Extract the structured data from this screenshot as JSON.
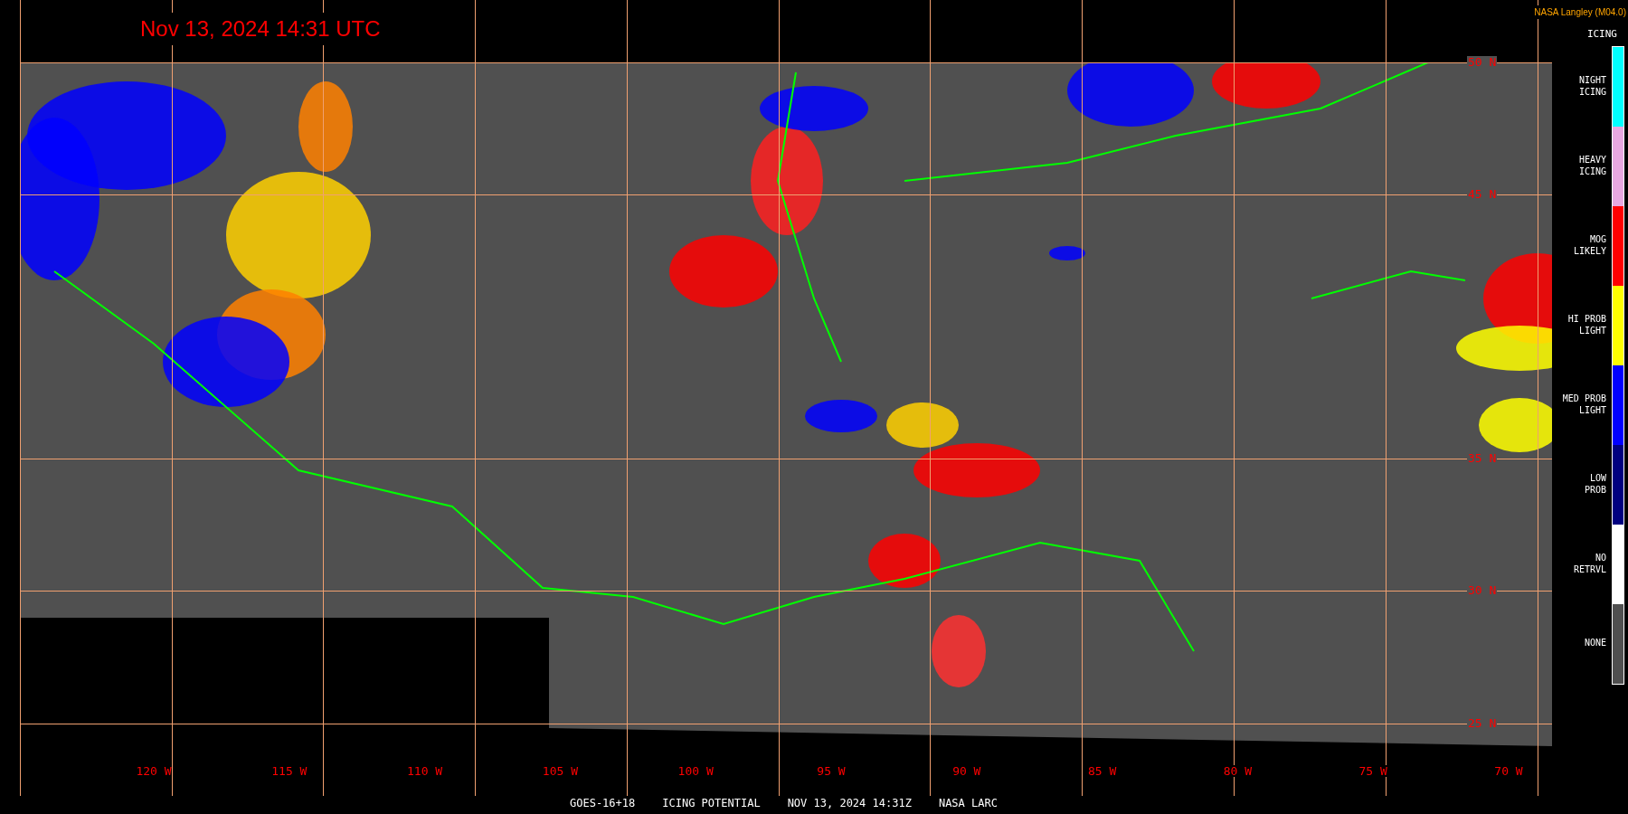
{
  "title": "Nov 13, 2024 14:31 UTC",
  "credit": "NASA Langley (M04.0)",
  "legend": {
    "title": "ICING",
    "items": [
      {
        "lines": [
          "NIGHT",
          "ICING"
        ],
        "color": "#00ffff"
      },
      {
        "lines": [
          "HEAVY",
          "ICING"
        ],
        "color": "#e8a8e0"
      },
      {
        "lines": [
          "MOG",
          "LIKELY"
        ],
        "color": "#ff0000"
      },
      {
        "lines": [
          "HI PROB",
          "LIGHT"
        ],
        "color": "#ffff00"
      },
      {
        "lines": [
          "MED PROB",
          "LIGHT"
        ],
        "color": "#0000ff"
      },
      {
        "lines": [
          "LOW",
          "PROB"
        ],
        "color": "#000080"
      },
      {
        "lines": [
          "NO",
          "RETRVL"
        ],
        "color": "#ffffff"
      },
      {
        "lines": [
          "NONE"
        ],
        "color": "#505050"
      }
    ]
  },
  "latitude_labels": [
    "50 N",
    "45 N",
    "35 N",
    "30 N",
    "25 N"
  ],
  "longitude_labels": [
    "120 W",
    "115 W",
    "110 W",
    "105 W",
    "100 W",
    "95 W",
    "90 W",
    "85 W",
    "80 W",
    "75 W",
    "70 W"
  ],
  "footer": [
    "GOES-16+18",
    "ICING POTENTIAL",
    "NOV 13, 2024 14:31Z",
    "NASA LARC"
  ]
}
